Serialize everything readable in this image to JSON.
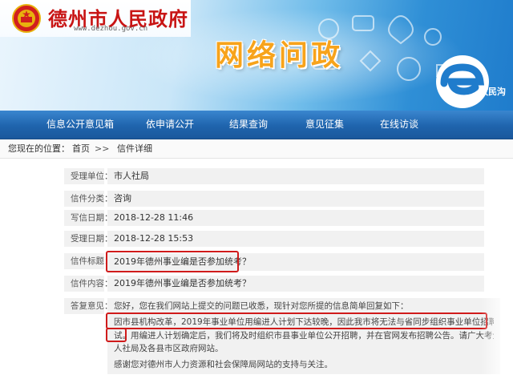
{
  "header": {
    "city_name": "德州市人民政府",
    "url": "www.dezhou.gov.cn",
    "site_title": "网络问政",
    "e_logo_text": "政民沟"
  },
  "nav": {
    "items": [
      {
        "label": "信息公开意见箱"
      },
      {
        "label": "依申请公开"
      },
      {
        "label": "结果查询"
      },
      {
        "label": "意见征集"
      },
      {
        "label": "在线访谈"
      }
    ]
  },
  "breadcrumb": {
    "prefix": "您现在的位置：",
    "home": "首页",
    "separator": ">>",
    "current": "信件详细"
  },
  "letter": {
    "fields": [
      {
        "label": "受理单位：",
        "value": "市人社局"
      },
      {
        "label": "信件分类：",
        "value": "咨询"
      },
      {
        "label": "写信日期：",
        "value": "2018-12-28 11:46"
      },
      {
        "label": "受理日期：",
        "value": "2018-12-28 15:53"
      },
      {
        "label": "信件标题：",
        "value": "2019年德州事业编是否参加统考？"
      },
      {
        "label": "信件内容：",
        "value": "2019年德州事业编是否参加统考？"
      }
    ],
    "reply_label": "答复意见：",
    "reply_lines": [
      "您好，您在我们网站上提交的问题已收悉，现针对您所提的信息简单回复如下：",
      "因市县机构改革，2019年事业单位用编进人计划下达较晚，因此我市将无法与省同步组织事业单位招聘报名考",
      "试。用编进人计划确定后，我们将及时组织市县事业单位公开招聘，并在官网发布招聘公告。请广大考生关注市",
      "人社局及各县市区政府网站。",
      "感谢您对德州市人力资源和社会保障局网站的支持与关注。"
    ]
  },
  "colors": {
    "nav_bg": "#1f64ad",
    "title_orange": "#f7a31b",
    "city_red": "#c81414",
    "highlight_red": "#d01b1b"
  }
}
